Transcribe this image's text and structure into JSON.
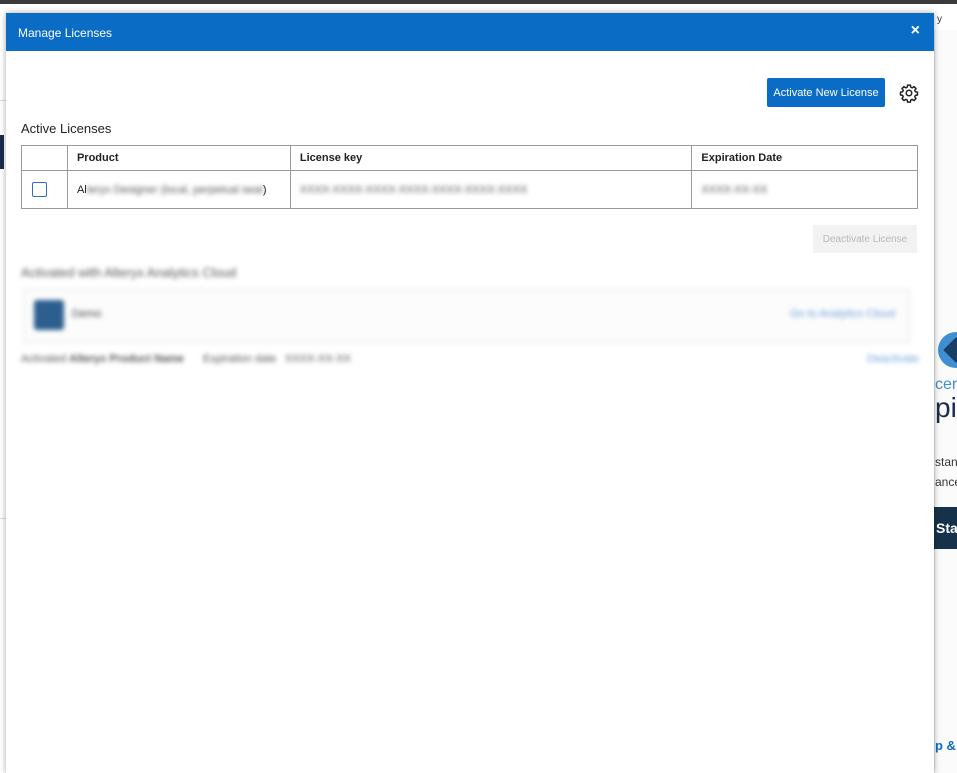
{
  "background": {
    "top_right_text": "y",
    "right_panel": {
      "line1": "cert",
      "line2": "pi",
      "line3": "stan",
      "line4": "ance",
      "start_label": "Star",
      "footer_link": "p & F"
    }
  },
  "dialog": {
    "title": "Manage Licenses",
    "close_label": "×",
    "activate_button": "Activate New License",
    "settings_icon": "gear-icon",
    "section_title": "Active Licenses",
    "table": {
      "headers": [
        "Product",
        "License key",
        "Expiration Date"
      ],
      "rows": [
        {
          "product": "Al",
          "product_blurred": "teryx Designer (local, perpetual seat",
          "product_tail": ")",
          "license_key": "XXXX-XXXX-XXXX-XXXX-XXXX-XXXX-XXXX",
          "expiration": "XXXX-XX-XX"
        }
      ]
    },
    "deactivate_button": "Deactivate License",
    "cloud": {
      "title": "Activated with Alteryx Analytics Cloud",
      "workspace": "Demo",
      "link": "Go to Analytics Cloud",
      "row_label": "Activated",
      "row_product": "Alteryx Product Name",
      "row_exp_label": "Expiration date",
      "row_exp_value": "XXXX-XX-XX",
      "row_action": "Deactivate"
    }
  }
}
